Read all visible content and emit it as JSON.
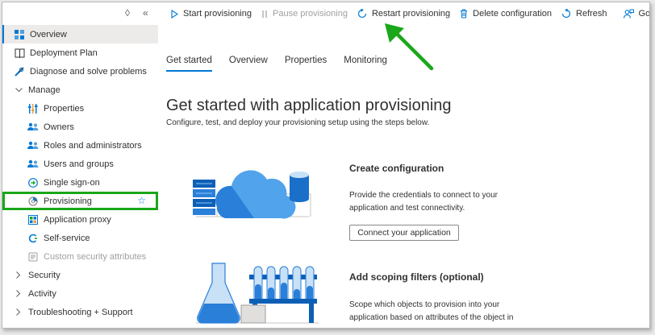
{
  "sidebar": {
    "pin_glyph": "◊",
    "collapse_glyph": "«",
    "items": [
      {
        "label": "Overview",
        "icon": "overview-grid-icon",
        "level": 0,
        "selected": true
      },
      {
        "label": "Deployment Plan",
        "icon": "book-icon",
        "level": 0
      },
      {
        "label": "Diagnose and solve problems",
        "icon": "wrench-icon",
        "level": 0
      },
      {
        "label": "Manage",
        "icon": "chevron-down-icon",
        "level": 0,
        "expanded": true
      },
      {
        "label": "Properties",
        "icon": "properties-bars-icon",
        "level": 1
      },
      {
        "label": "Owners",
        "icon": "people-icon",
        "level": 1
      },
      {
        "label": "Roles and administrators",
        "icon": "people-icon",
        "level": 1
      },
      {
        "label": "Users and groups",
        "icon": "people-icon",
        "level": 1
      },
      {
        "label": "Single sign-on",
        "icon": "sso-arrow-icon",
        "level": 1
      },
      {
        "label": "Provisioning",
        "icon": "provisioning-gear-icon",
        "level": 1,
        "highlighted": true
      },
      {
        "label": "Application proxy",
        "icon": "app-proxy-icon",
        "level": 1
      },
      {
        "label": "Self-service",
        "icon": "self-service-icon",
        "level": 1
      },
      {
        "label": "Custom security attributes",
        "icon": "attributes-icon",
        "level": 1,
        "disabled": true
      },
      {
        "label": "Security",
        "icon": "chevron-right-icon",
        "level": 0
      },
      {
        "label": "Activity",
        "icon": "chevron-right-icon",
        "level": 0
      },
      {
        "label": "Troubleshooting + Support",
        "icon": "chevron-right-icon",
        "level": 0
      }
    ]
  },
  "toolbar": {
    "start": "Start provisioning",
    "pause": "Pause provisioning",
    "restart": "Restart provisioning",
    "delete": "Delete configuration",
    "refresh": "Refresh",
    "feedback": "Got feedback?"
  },
  "tabs": [
    "Get started",
    "Overview",
    "Properties",
    "Monitoring"
  ],
  "active_tab": "Get started",
  "main": {
    "title": "Get started with application provisioning",
    "subtitle": "Configure, test, and deploy your provisioning setup using the steps below.",
    "steps": [
      {
        "title": "Create configuration",
        "description": "Provide the credentials to connect to your application and test connectivity.",
        "button": "Connect your application"
      },
      {
        "title": "Add scoping filters (optional)",
        "description": "Scope which objects to provision into your application based on attributes of the object in"
      }
    ]
  },
  "colors": {
    "accent": "#0078d4",
    "highlight_box": "#1aa71a",
    "arrow": "#1aa71a"
  }
}
